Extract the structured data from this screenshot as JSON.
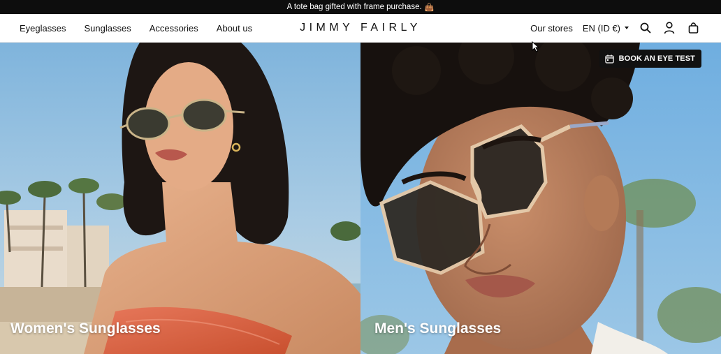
{
  "promo": {
    "text": "A tote bag gifted with frame purchase.",
    "icon": "shopping-bag-emoji"
  },
  "header": {
    "nav_left": [
      "Eyeglasses",
      "Sunglasses",
      "Accessories",
      "About us"
    ],
    "logo": "JIMMY FAIRLY",
    "stores_label": "Our stores",
    "language_label": "EN (ID €)",
    "icons": [
      "search-icon",
      "account-icon",
      "cart-icon"
    ]
  },
  "hero": {
    "women_label": "Women's Sunglasses",
    "men_label": "Men's Sunglasses",
    "eye_test_label": "BOOK AN EYE TEST"
  },
  "colors": {
    "bar": "#0d0d0d",
    "text": "#111111",
    "button": "#111111"
  }
}
